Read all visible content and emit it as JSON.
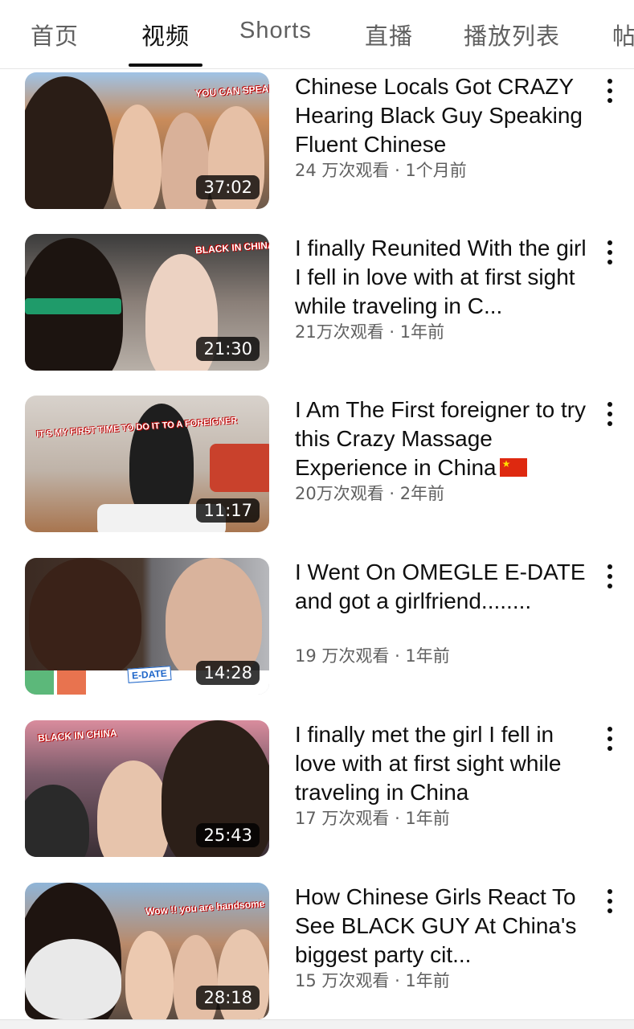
{
  "tabs": [
    {
      "label": "首页"
    },
    {
      "label": "视频"
    },
    {
      "label": "Shorts"
    },
    {
      "label": "直播"
    },
    {
      "label": "播放列表"
    },
    {
      "label": "帖"
    }
  ],
  "active_tab": "视频",
  "videos": [
    {
      "title": "Chinese Locals Got CRAZY Hearing Black Guy Speaking Fluent Chinese",
      "meta": "24 万次观看 · 1个月前",
      "duration": "37:02",
      "thumb_text": "YOU CAN SPEAK!!"
    },
    {
      "title": "I finally Reunited With the girl I fell in love with at first sight while traveling in C...",
      "meta": "21万次观看 · 1年前",
      "duration": "21:30",
      "thumb_text": "BLACK IN CHINA"
    },
    {
      "title": "I Am The First foreigner to try this Crazy Massage Experience  in China",
      "meta": "20万次观看 · 2年前",
      "duration": "11:17",
      "thumb_text": "IT'S MY FIRST TIME TO DO IT TO A FOREIGNER"
    },
    {
      "title": "I Went On OMEGLE  E-DATE and got a girlfriend........",
      "meta": "19 万次观看 · 1年前",
      "duration": "14:28",
      "thumb_text": "E-DATE"
    },
    {
      "title": "I finally met the girl I fell in love with at first sight while traveling in China",
      "meta": "17 万次观看 · 1年前",
      "duration": "25:43",
      "thumb_text": "BLACK IN CHINA"
    },
    {
      "title": "How Chinese Girls React To See BLACK GUY At China's biggest party cit...",
      "meta": "15 万次观看 · 1年前",
      "duration": "28:18",
      "thumb_text": "Wow !! you are handsome"
    }
  ],
  "colors": {
    "text_primary": "#0f0f0f",
    "text_secondary": "#606060",
    "duration_bg": "#000000"
  },
  "icons": {
    "menu": "more-vertical-icon",
    "flag": "china-flag-icon"
  }
}
